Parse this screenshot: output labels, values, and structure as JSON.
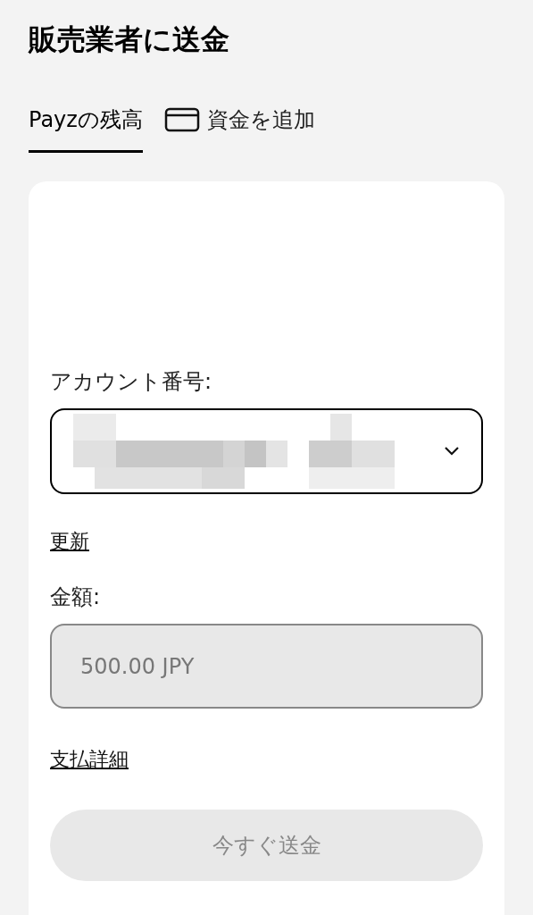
{
  "title": "販売業者に送金",
  "tabs": [
    {
      "label": "Payzの残高",
      "selected": true,
      "kind": "plain"
    },
    {
      "label": "資金を追加",
      "selected": false,
      "kind": "card"
    }
  ],
  "form": {
    "account_label": "アカウント番号:",
    "account_select": {
      "kind": "redacted"
    },
    "refresh_link": "更新",
    "amount_label": "金額:",
    "amount_field": {
      "value": "500.00 JPY",
      "disabled": true
    },
    "details_link": "支払詳細",
    "send_button": {
      "label": "今すぐ送金",
      "disabled": true
    }
  }
}
